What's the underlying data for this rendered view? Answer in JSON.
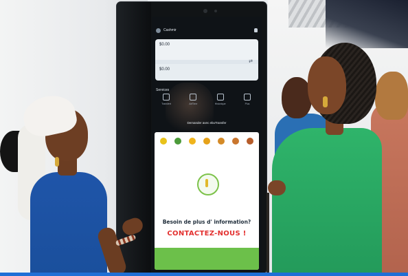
{
  "screen": {
    "app_title": "Cashmir",
    "top_amount": "$0.00",
    "bottom_amount": "$0.00",
    "services_label": "Services",
    "services": [
      {
        "label": "Transfert",
        "icon": "transfer-icon"
      },
      {
        "label": "AirTime",
        "icon": "phone-icon"
      },
      {
        "label": "Historique",
        "icon": "history-icon"
      },
      {
        "label": "Plus",
        "icon": "more-icon"
      }
    ],
    "demander_text": "Demander avec ebuTransfer",
    "banner": {
      "besoin_text": "Besoin de plus d' information?",
      "contactez_text": "CONTACTEZ-NOUS !",
      "fruits": [
        {
          "color": "#e8c21a"
        },
        {
          "color": "#4c9b3a"
        },
        {
          "color": "#f0b41c"
        },
        {
          "color": "#e6a21a"
        },
        {
          "color": "#d48a27"
        },
        {
          "color": "#c9762e"
        },
        {
          "color": "#b65c2a"
        }
      ],
      "accent_color": "#e3302f",
      "band_color": "#6cc04a"
    }
  }
}
